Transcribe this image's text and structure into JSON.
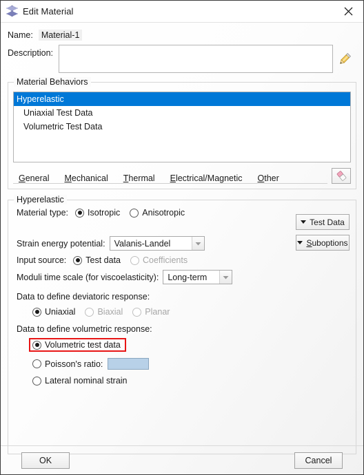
{
  "window": {
    "title": "Edit Material",
    "icon": "material-diamond-icon",
    "close_label": "×"
  },
  "name": {
    "label": "Name:",
    "value": "Material-1"
  },
  "description": {
    "label": "Description:",
    "value": "",
    "edit_icon": "pencil-icon"
  },
  "material_behaviors": {
    "legend": "Material Behaviors",
    "items": [
      {
        "label": "Hyperelastic",
        "selected": true,
        "child": false
      },
      {
        "label": "Uniaxial Test Data",
        "selected": false,
        "child": true
      },
      {
        "label": "Volumetric Test Data",
        "selected": false,
        "child": true
      }
    ],
    "selection_color": "#0078d7"
  },
  "tabs": [
    {
      "label": "General",
      "mnemonic": "G"
    },
    {
      "label": "Mechanical",
      "mnemonic": "M"
    },
    {
      "label": "Thermal",
      "mnemonic": "T"
    },
    {
      "label": "Electrical/Magnetic",
      "mnemonic": "E"
    },
    {
      "label": "Other",
      "mnemonic": "O"
    }
  ],
  "tabbar_tool": {
    "icon": "eraser-icon"
  },
  "hyperelastic": {
    "legend": "Hyperelastic",
    "material_type": {
      "label": "Material type:",
      "options": [
        {
          "label": "Isotropic",
          "checked": true,
          "disabled": false
        },
        {
          "label": "Anisotropic",
          "checked": false,
          "disabled": false
        }
      ]
    },
    "strain_energy_potential": {
      "label": "Strain energy potential:",
      "value": "Valanis-Landel"
    },
    "input_source": {
      "label": "Input source:",
      "options": [
        {
          "label": "Test data",
          "checked": true,
          "disabled": false
        },
        {
          "label": "Coefficients",
          "checked": false,
          "disabled": true
        }
      ]
    },
    "moduli_time_scale": {
      "label": "Moduli time scale (for viscoelasticity):",
      "value": "Long-term"
    },
    "deviatoric": {
      "label": "Data to define deviatoric response:",
      "options": [
        {
          "label": "Uniaxial",
          "checked": true,
          "disabled": false
        },
        {
          "label": "Biaxial",
          "checked": false,
          "disabled": true
        },
        {
          "label": "Planar",
          "checked": false,
          "disabled": true
        }
      ]
    },
    "volumetric": {
      "label": "Data to define volumetric response:",
      "options": [
        {
          "label": "Volumetric test data",
          "checked": true,
          "disabled": false,
          "highlighted": true
        },
        {
          "label": "Poisson's ratio:",
          "checked": false,
          "disabled": false,
          "has_input": true,
          "input_value": ""
        },
        {
          "label": "Lateral nominal strain",
          "checked": false,
          "disabled": false
        }
      ],
      "highlight_color": "#e81515",
      "input_bg_color": "#b8d1e8"
    },
    "side_buttons": [
      {
        "label": "Test Data",
        "mnemonic": ""
      },
      {
        "label": "Suboptions",
        "mnemonic": "S"
      }
    ]
  },
  "footer": {
    "ok_label": "OK",
    "cancel_label": "Cancel"
  }
}
